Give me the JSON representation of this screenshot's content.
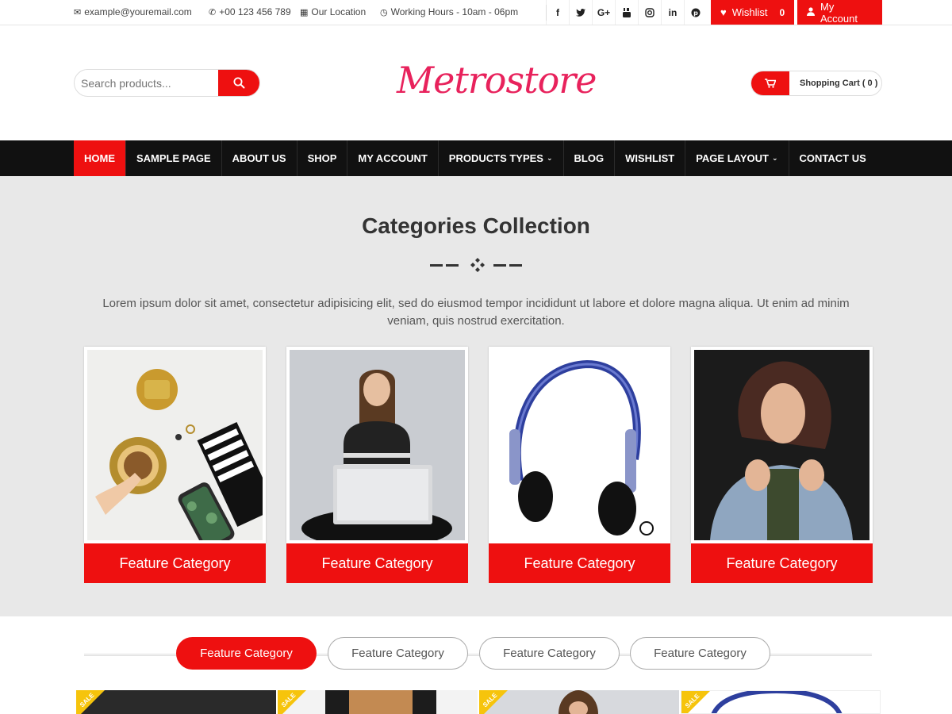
{
  "topbar": {
    "email": "example@youremail.com",
    "phone": "+00 123 456 789",
    "location": "Our Location",
    "hours": "Working Hours - 10am - 06pm",
    "social": [
      "f",
      "t",
      "G+",
      "yt",
      "ig",
      "in",
      "p"
    ],
    "wishlist_label": "Wishlist",
    "wishlist_count": "0",
    "account_label": "My Account"
  },
  "header": {
    "search_placeholder": "Search products...",
    "logo": "Metrostore",
    "cart_label": "Shopping Cart ( 0 )"
  },
  "nav": {
    "items": [
      {
        "label": "HOME",
        "active": true
      },
      {
        "label": "SAMPLE PAGE"
      },
      {
        "label": "ABOUT US"
      },
      {
        "label": "SHOP"
      },
      {
        "label": "MY ACCOUNT"
      },
      {
        "label": "PRODUCTS TYPES",
        "dropdown": true
      },
      {
        "label": "BLOG"
      },
      {
        "label": "WISHLIST"
      },
      {
        "label": "PAGE LAYOUT",
        "dropdown": true
      },
      {
        "label": "CONTACT US"
      }
    ]
  },
  "categories": {
    "title": "Categories Collection",
    "description": "Lorem ipsum dolor sit amet, consectetur adipisicing elit, sed do eiusmod tempor incididunt ut labore et dolore magna aliqua. Ut enim ad minim veniam, quis nostrud exercitation.",
    "cards": [
      {
        "label": "Feature Category"
      },
      {
        "label": "Feature Category"
      },
      {
        "label": "Feature Category"
      },
      {
        "label": "Feature Category"
      }
    ]
  },
  "tabs": {
    "items": [
      {
        "label": "Feature Category",
        "active": true
      },
      {
        "label": "Feature Category"
      },
      {
        "label": "Feature Category"
      },
      {
        "label": "Feature Category"
      }
    ]
  },
  "products": {
    "badge": "SALE"
  },
  "colors": {
    "accent": "#ee1010",
    "logo": "#e8225c",
    "nav_bg": "#111111",
    "section_bg": "#e8e8e8"
  }
}
